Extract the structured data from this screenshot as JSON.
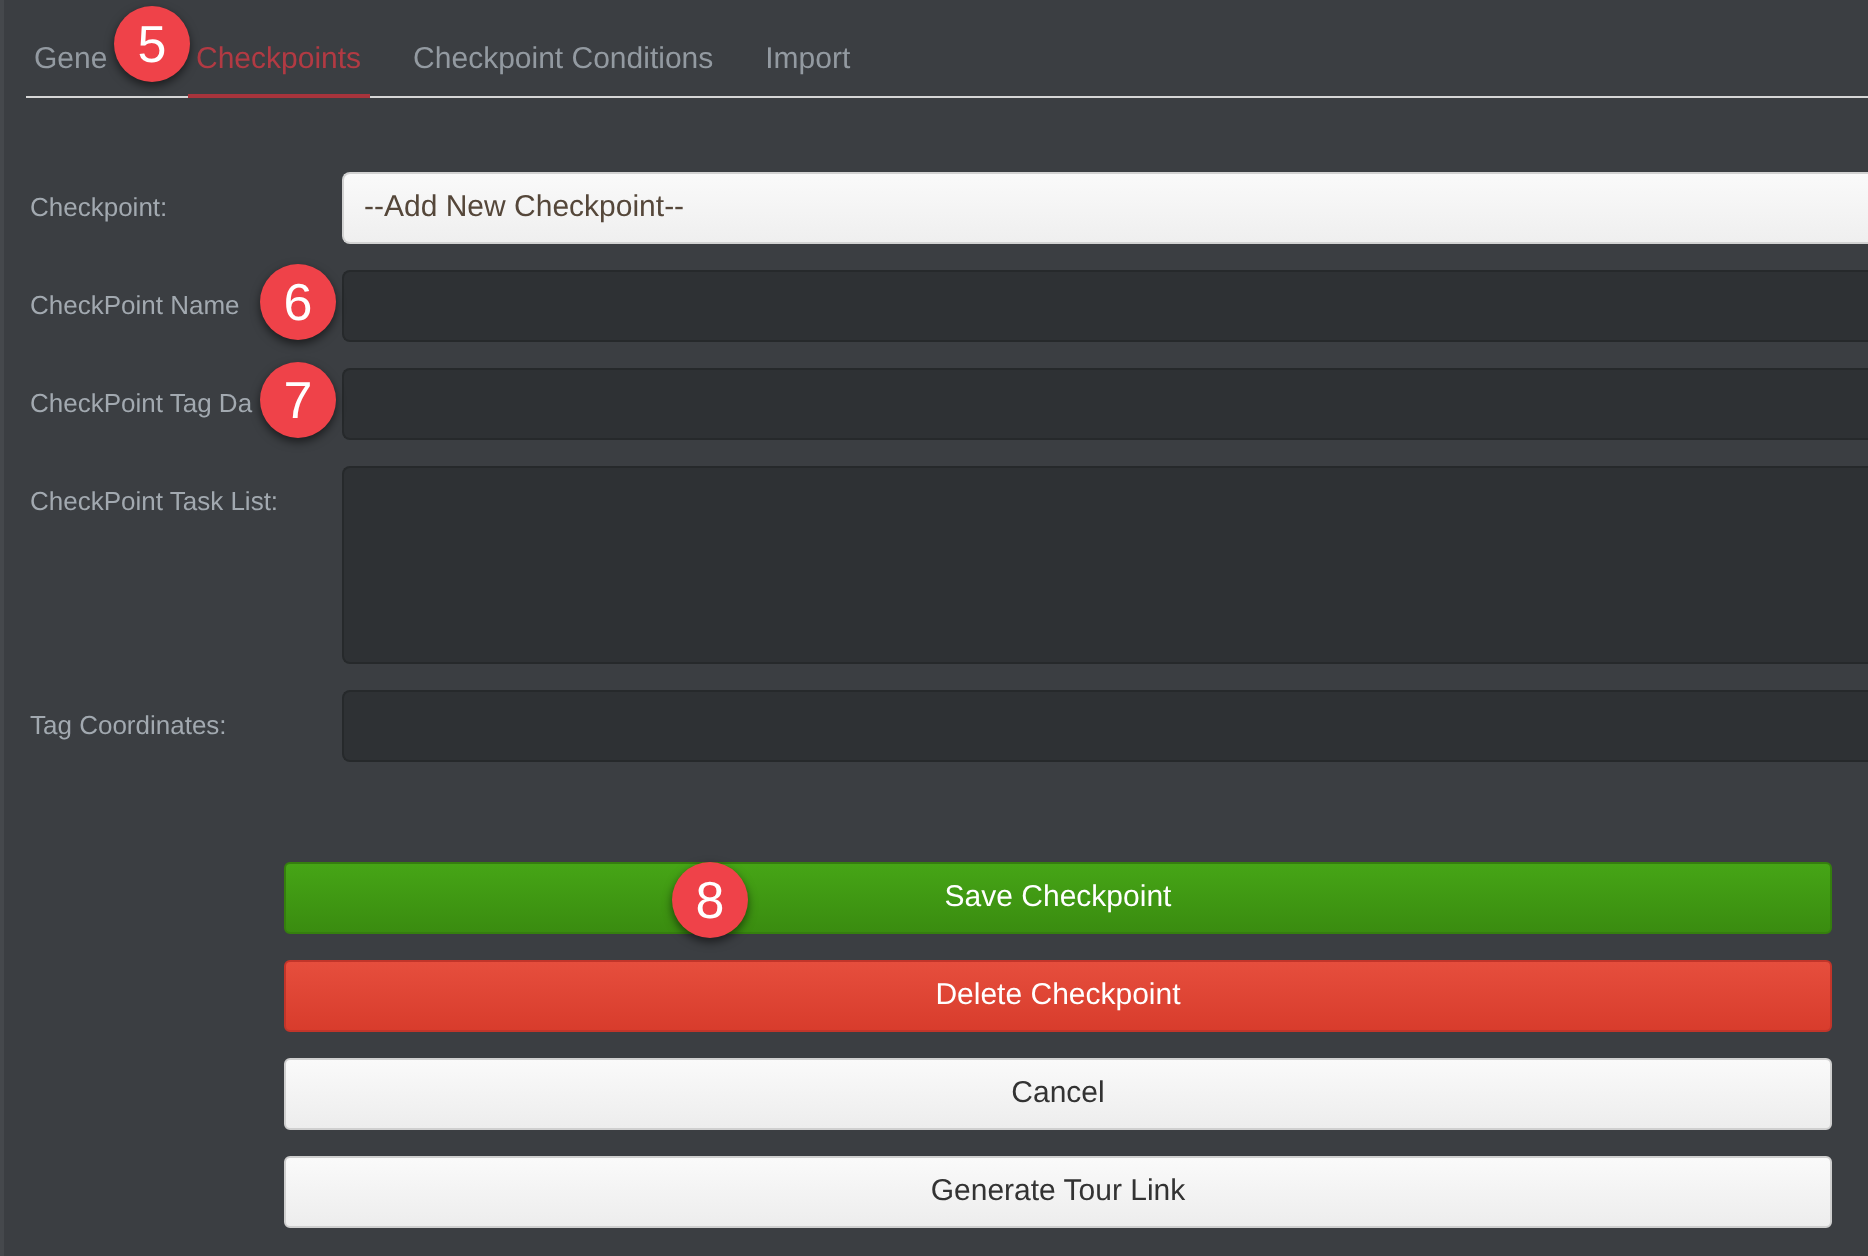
{
  "tabs": [
    {
      "label": "Gene",
      "selected": false
    },
    {
      "label": "Checkpoints",
      "selected": true
    },
    {
      "label": "Checkpoint Conditions",
      "selected": false
    },
    {
      "label": "Import",
      "selected": false
    }
  ],
  "form": {
    "fields": [
      {
        "kind": "select",
        "label": "Checkpoint:",
        "value": "--Add New Checkpoint--"
      },
      {
        "kind": "input",
        "label": "CheckPoint Name"
      },
      {
        "kind": "input",
        "label": "CheckPoint Tag Da"
      },
      {
        "kind": "textarea",
        "label": "CheckPoint Task List:"
      },
      {
        "kind": "input",
        "label": "Tag Coordinates:"
      }
    ]
  },
  "buttons": [
    {
      "kind": "success",
      "label": "Save Checkpoint"
    },
    {
      "kind": "danger",
      "label": "Delete Checkpoint"
    },
    {
      "kind": "default",
      "label": "Cancel"
    },
    {
      "kind": "default",
      "label": "Generate Tour Link"
    }
  ],
  "callouts": [
    "5",
    "6",
    "7",
    "8"
  ]
}
